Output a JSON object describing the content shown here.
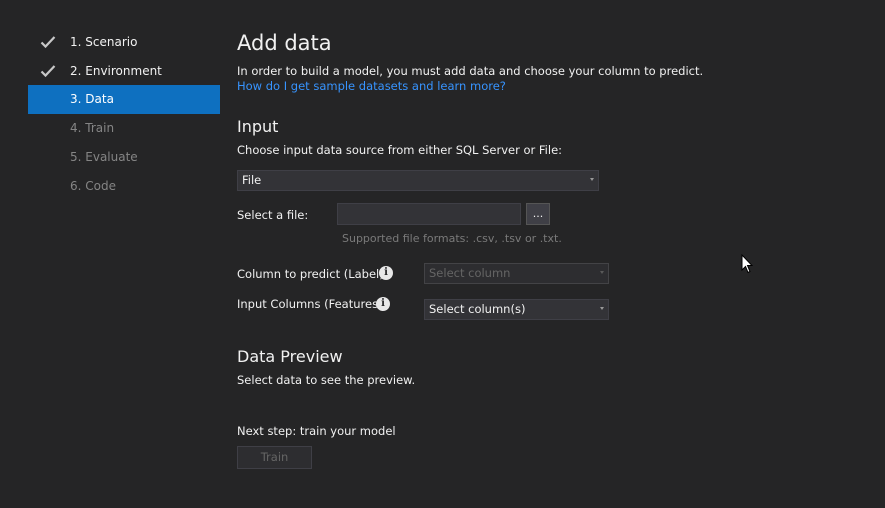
{
  "sidebar": {
    "items": [
      {
        "label": "1. Scenario",
        "state": "done"
      },
      {
        "label": "2. Environment",
        "state": "done"
      },
      {
        "label": "3. Data",
        "state": "active"
      },
      {
        "label": "4. Train",
        "state": "pending"
      },
      {
        "label": "5. Evaluate",
        "state": "pending"
      },
      {
        "label": "6. Code",
        "state": "pending"
      }
    ]
  },
  "main": {
    "title": "Add data",
    "description": "In order to build a model, you must add data and choose your column to predict.",
    "help_link": "How do I get sample datasets and learn more?",
    "input": {
      "heading": "Input",
      "subheading": "Choose input data source from either SQL Server or File:",
      "source_value": "File",
      "file_label": "Select a file:",
      "file_value": "",
      "browse_label": "...",
      "formats_hint": "Supported file formats: .csv, .tsv or .txt.",
      "label_column_label": "Column to predict (Label):",
      "label_column_placeholder": "Select column",
      "features_label": "Input Columns (Features):",
      "features_value": "Select column(s)",
      "info_icon": "i"
    },
    "preview": {
      "heading": "Data Preview",
      "text": "Select data to see the preview."
    },
    "next": {
      "text": "Next step: train your model",
      "train_label": "Train"
    }
  },
  "colors": {
    "background": "#252526",
    "accent": "#0e70c0",
    "link": "#3794ff"
  }
}
